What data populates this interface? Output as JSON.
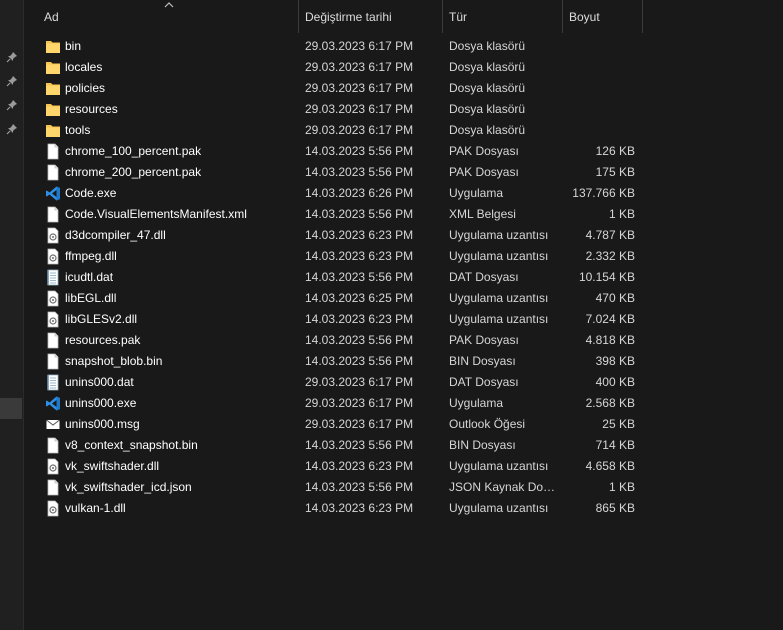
{
  "header": {
    "name_label": "Ad",
    "date_label": "Değiştirme tarihi",
    "type_label": "Tür",
    "size_label": "Boyut"
  },
  "nav": {
    "pins": [
      "pin-icon",
      "pin-icon",
      "pin-icon",
      "pin-icon"
    ]
  },
  "colors": {
    "folder": "#f5c451",
    "background": "#191919",
    "vscode_blue": "#2d8fe6"
  },
  "files": [
    {
      "name": "bin",
      "date": "29.03.2023 6:17 PM",
      "type": "Dosya klasörü",
      "size": "",
      "icon": "folder"
    },
    {
      "name": "locales",
      "date": "29.03.2023 6:17 PM",
      "type": "Dosya klasörü",
      "size": "",
      "icon": "folder"
    },
    {
      "name": "policies",
      "date": "29.03.2023 6:17 PM",
      "type": "Dosya klasörü",
      "size": "",
      "icon": "folder"
    },
    {
      "name": "resources",
      "date": "29.03.2023 6:17 PM",
      "type": "Dosya klasörü",
      "size": "",
      "icon": "folder"
    },
    {
      "name": "tools",
      "date": "29.03.2023 6:17 PM",
      "type": "Dosya klasörü",
      "size": "",
      "icon": "folder"
    },
    {
      "name": "chrome_100_percent.pak",
      "date": "14.03.2023 5:56 PM",
      "type": "PAK Dosyası",
      "size": "126 KB",
      "icon": "file"
    },
    {
      "name": "chrome_200_percent.pak",
      "date": "14.03.2023 5:56 PM",
      "type": "PAK Dosyası",
      "size": "175 KB",
      "icon": "file"
    },
    {
      "name": "Code.exe",
      "date": "14.03.2023 6:26 PM",
      "type": "Uygulama",
      "size": "137.766 KB",
      "icon": "vscode"
    },
    {
      "name": "Code.VisualElementsManifest.xml",
      "date": "14.03.2023 5:56 PM",
      "type": "XML Belgesi",
      "size": "1 KB",
      "icon": "file"
    },
    {
      "name": "d3dcompiler_47.dll",
      "date": "14.03.2023 6:23 PM",
      "type": "Uygulama uzantısı",
      "size": "4.787 KB",
      "icon": "dll"
    },
    {
      "name": "ffmpeg.dll",
      "date": "14.03.2023 6:23 PM",
      "type": "Uygulama uzantısı",
      "size": "2.332 KB",
      "icon": "dll"
    },
    {
      "name": "icudtl.dat",
      "date": "14.03.2023 5:56 PM",
      "type": "DAT Dosyası",
      "size": "10.154 KB",
      "icon": "dat"
    },
    {
      "name": "libEGL.dll",
      "date": "14.03.2023 6:25 PM",
      "type": "Uygulama uzantısı",
      "size": "470 KB",
      "icon": "dll"
    },
    {
      "name": "libGLESv2.dll",
      "date": "14.03.2023 6:23 PM",
      "type": "Uygulama uzantısı",
      "size": "7.024 KB",
      "icon": "dll"
    },
    {
      "name": "resources.pak",
      "date": "14.03.2023 5:56 PM",
      "type": "PAK Dosyası",
      "size": "4.818 KB",
      "icon": "file"
    },
    {
      "name": "snapshot_blob.bin",
      "date": "14.03.2023 5:56 PM",
      "type": "BIN Dosyası",
      "size": "398 KB",
      "icon": "file"
    },
    {
      "name": "unins000.dat",
      "date": "29.03.2023 6:17 PM",
      "type": "DAT Dosyası",
      "size": "400 KB",
      "icon": "dat"
    },
    {
      "name": "unins000.exe",
      "date": "29.03.2023 6:17 PM",
      "type": "Uygulama",
      "size": "2.568 KB",
      "icon": "vscode"
    },
    {
      "name": "unins000.msg",
      "date": "29.03.2023 6:17 PM",
      "type": "Outlook Öğesi",
      "size": "25 KB",
      "icon": "mail"
    },
    {
      "name": "v8_context_snapshot.bin",
      "date": "14.03.2023 5:56 PM",
      "type": "BIN Dosyası",
      "size": "714 KB",
      "icon": "file"
    },
    {
      "name": "vk_swiftshader.dll",
      "date": "14.03.2023 6:23 PM",
      "type": "Uygulama uzantısı",
      "size": "4.658 KB",
      "icon": "dll"
    },
    {
      "name": "vk_swiftshader_icd.json",
      "date": "14.03.2023 5:56 PM",
      "type": "JSON Kaynak Dos...",
      "size": "1 KB",
      "icon": "file"
    },
    {
      "name": "vulkan-1.dll",
      "date": "14.03.2023 6:23 PM",
      "type": "Uygulama uzantısı",
      "size": "865 KB",
      "icon": "dll"
    }
  ]
}
